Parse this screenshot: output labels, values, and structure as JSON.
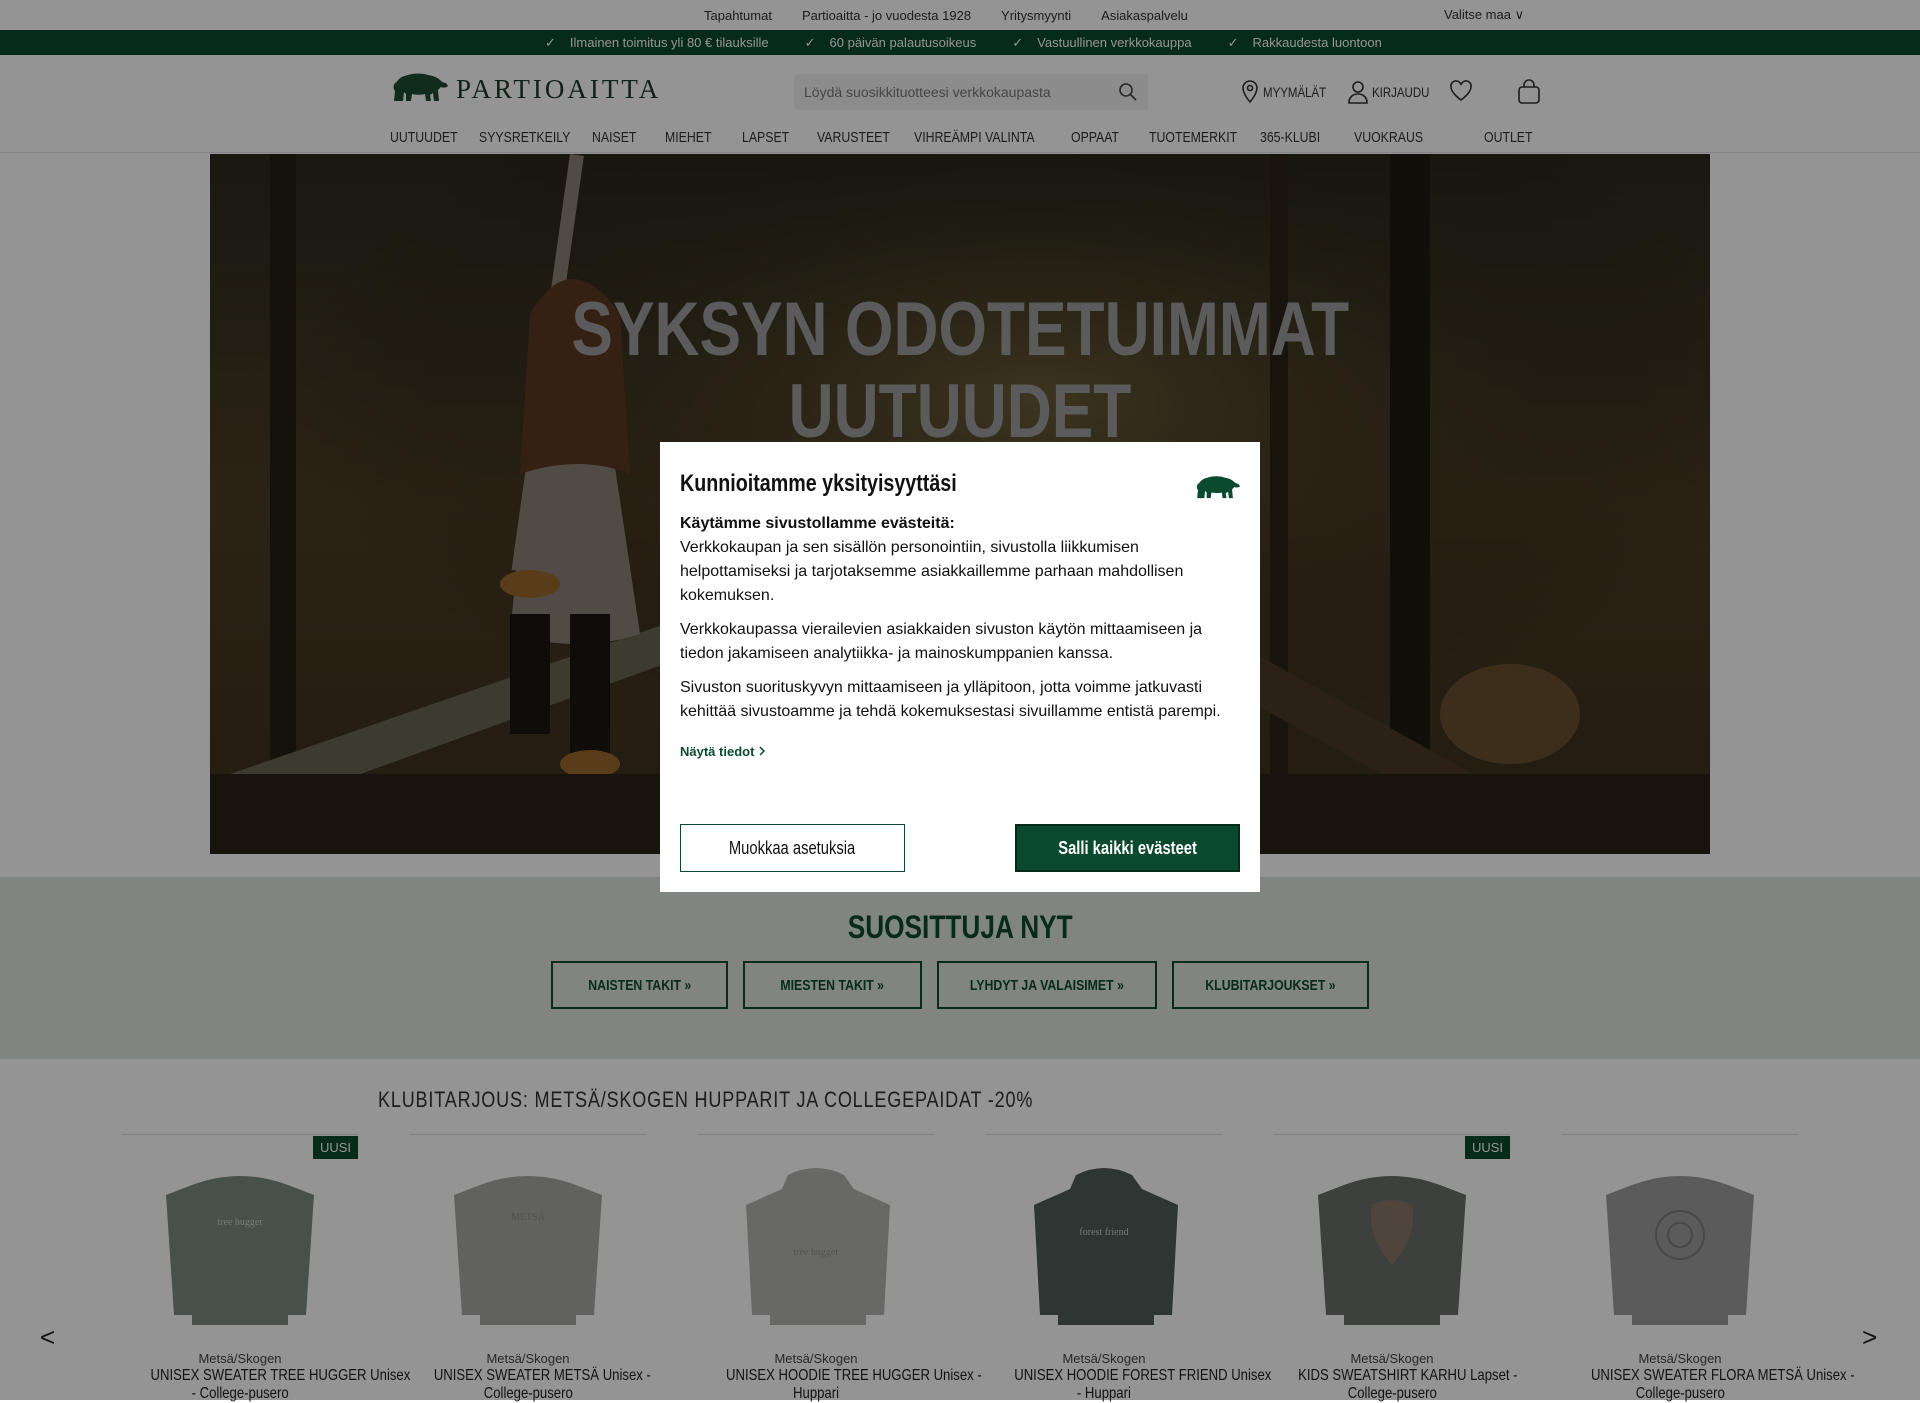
{
  "topbar": {
    "links": [
      "Tapahtumat",
      "Partioaitta - jo vuodesta 1928",
      "Yritysmyynti",
      "Asiakaspalvelu"
    ],
    "country": "Valitse maa  ∨"
  },
  "usp": [
    "Ilmainen toimitus yli 80 € tilauksille",
    "60 päivän palautusoikeus",
    "Vastuullinen verkkokauppa",
    "Rakkaudesta luontoon"
  ],
  "usp_check": "✓",
  "header": {
    "logo_text": "PARTIOAITTA",
    "search_placeholder": "Löydä suosikkituotteesi verkkokaupasta",
    "stores": "MYYMÄLÄT",
    "login": "KIRJAUDU"
  },
  "nav": [
    "UUTUUDET",
    "SYYSRETKEILY",
    "NAISET",
    "MIEHET",
    "LAPSET",
    "VARUSTEET",
    "VIHREÄMPI VALINTA",
    "OPPAAT",
    "TUOTEMERKIT",
    "365-KLUBI",
    "VUOKRAUS",
    "OUTLET"
  ],
  "hero": {
    "line1": "SYKSYN ODOTETUIMMAT",
    "line2": "UUTUUDET"
  },
  "popular": {
    "title": "SUOSITTUJA NYT",
    "buttons": [
      "NAISTEN TAKIT »",
      "MIESTEN TAKIT »",
      "LYHDYT JA VALAISIMET »",
      "KLUBITARJOUKSET »"
    ]
  },
  "offer": {
    "title": "KLUBITARJOUS: METSÄ/SKOGEN HUPPARIT JA COLLEGEPAIDAT -20%",
    "products": [
      {
        "brand": "Metsä/Skogen",
        "name_1": "UNISEX SWEATER TREE HUGGER Unisex",
        "name_2": "- College-pusero",
        "badge": "UUSI",
        "print": "tree hugger"
      },
      {
        "brand": "Metsä/Skogen",
        "name_1": "UNISEX SWEATER METSÄ Unisex -",
        "name_2": "College-pusero",
        "badge": "",
        "print": "METSÄ"
      },
      {
        "brand": "Metsä/Skogen",
        "name_1": "UNISEX HOODIE TREE HUGGER Unisex -",
        "name_2": "Huppari",
        "badge": "",
        "print": "tree hugger"
      },
      {
        "brand": "Metsä/Skogen",
        "name_1": "UNISEX HOODIE FOREST FRIEND Unisex",
        "name_2": "- Huppari",
        "badge": "",
        "print": "forest friend"
      },
      {
        "brand": "Metsä/Skogen",
        "name_1": "KIDS SWEATSHIRT KARHU Lapset -",
        "name_2": "College-pusero",
        "badge": "UUSI",
        "print": ""
      },
      {
        "brand": "Metsä/Skogen",
        "name_1": "UNISEX SWEATER FLORA METSÄ Unisex -",
        "name_2": "College-pusero",
        "badge": "",
        "print": ""
      }
    ],
    "prev": "<",
    "next": ">"
  },
  "cookie": {
    "title": "Kunnioitamme yksityisyyttäsi",
    "lead": "Käytämme sivustollamme evästeitä:",
    "p1": "Verkkokaupan ja sen sisällön personointiin, sivustolla liikkumisen helpottamiseksi ja tarjotaksemme asiakkaillemme parhaan mahdollisen kokemuksen.",
    "p2": "Verkkokaupassa vierailevien asiakkaiden sivuston käytön mittaamiseen ja tiedon jakamiseen analytiikka- ja mainoskumppanien kanssa.",
    "p3": "Sivuston suorituskyvyn mittaamiseen ja ylläpitoon, jotta voimme jatkuvasti kehittää sivustoamme ja tehdä kokemuksestasi sivuillamme entistä parempi.",
    "more": "Näytä tiedot",
    "btn_edit": "Muokkaa asetuksia",
    "btn_all": "Salli kaikki evästeet"
  },
  "colors": {
    "brand_green": "#0b4a2e",
    "popular_bg": "#dfe6e0"
  }
}
